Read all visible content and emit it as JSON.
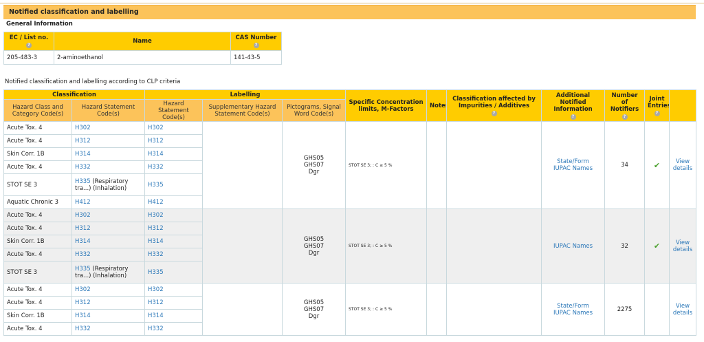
{
  "section_title": "Notified classification and labelling",
  "general": {
    "title": "General Information",
    "headers": {
      "ec": "EC / List no.",
      "name": "Name",
      "cas": "CAS Number"
    },
    "row": {
      "ec": "205-483-3",
      "name": "2-aminoethanol",
      "cas": "141-43-5"
    }
  },
  "criteria_note": "Notified classification and labelling according to CLP criteria",
  "table": {
    "groups": {
      "classification": "Classification",
      "labelling": "Labelling"
    },
    "headers": {
      "hazard_class": "Hazard Class and Category Code(s)",
      "hazard_statement": "Hazard Statement Code(s)",
      "lab_hazard_statement": "Hazard Statement Code(s)",
      "supplementary": "Supplementary Hazard Statement Code(s)",
      "pictograms": "Pictograms, Signal Word Code(s)",
      "scl": "Specific Concentration limits, M-Factors",
      "notes": "Notes",
      "impurities": "Classification affected by Impurities / Additives",
      "additional": "Additional Notified Information",
      "notifiers": "Number of Notifiers",
      "joint": "Joint Entries"
    },
    "help_icon": "?",
    "blocks": [
      {
        "rows": [
          {
            "cls": "Acute Tox. 4",
            "hs": "H302",
            "hs_extra": "",
            "lab": "H302"
          },
          {
            "cls": "Acute Tox. 4",
            "hs": "H312",
            "hs_extra": "",
            "lab": "H312"
          },
          {
            "cls": "Skin Corr. 1B",
            "hs": "H314",
            "hs_extra": "",
            "lab": "H314"
          },
          {
            "cls": "Acute Tox. 4",
            "hs": "H332",
            "hs_extra": "",
            "lab": "H332"
          },
          {
            "cls": "STOT SE 3",
            "hs": "H335",
            "hs_extra": " (Respiratory tra...) (Inhalation)",
            "lab": "H335"
          },
          {
            "cls": "Aquatic Chronic 3",
            "hs": "H412",
            "hs_extra": "",
            "lab": "H412"
          }
        ],
        "pictograms": [
          "GHS05",
          "GHS07",
          "Dgr"
        ],
        "scl": "STOT SE 3; : C ≥ 5 %",
        "additional": [
          "State/Form",
          "IUPAC Names"
        ],
        "notifiers": "34",
        "joint": true,
        "view": [
          "View",
          "details"
        ]
      },
      {
        "rows": [
          {
            "cls": "Acute Tox. 4",
            "hs": "H302",
            "hs_extra": "",
            "lab": "H302"
          },
          {
            "cls": "Acute Tox. 4",
            "hs": "H312",
            "hs_extra": "",
            "lab": "H312"
          },
          {
            "cls": "Skin Corr. 1B",
            "hs": "H314",
            "hs_extra": "",
            "lab": "H314"
          },
          {
            "cls": "Acute Tox. 4",
            "hs": "H332",
            "hs_extra": "",
            "lab": "H332"
          },
          {
            "cls": "STOT SE 3",
            "hs": "H335",
            "hs_extra": " (Respiratory tra...) (Inhalation)",
            "lab": "H335"
          }
        ],
        "pictograms": [
          "GHS05",
          "GHS07",
          "Dgr"
        ],
        "scl": "STOT SE 3; : C ≥ 5 %",
        "additional": [
          "IUPAC Names"
        ],
        "notifiers": "32",
        "joint": true,
        "view": [
          "View",
          "details"
        ]
      },
      {
        "rows": [
          {
            "cls": "Acute Tox. 4",
            "hs": "H302",
            "hs_extra": "",
            "lab": "H302"
          },
          {
            "cls": "Acute Tox. 4",
            "hs": "H312",
            "hs_extra": "",
            "lab": "H312"
          },
          {
            "cls": "Skin Corr. 1B",
            "hs": "H314",
            "hs_extra": "",
            "lab": "H314"
          },
          {
            "cls": "Acute Tox. 4",
            "hs": "H332",
            "hs_extra": "",
            "lab": "H332"
          }
        ],
        "pictograms": [
          "GHS05",
          "GHS07",
          "Dgr"
        ],
        "scl": "STOT SE 3; : C ≥ 5 %",
        "additional": [
          "State/Form",
          "IUPAC Names"
        ],
        "notifiers": "2275",
        "joint": false,
        "view": [
          "View",
          "details"
        ]
      }
    ]
  }
}
